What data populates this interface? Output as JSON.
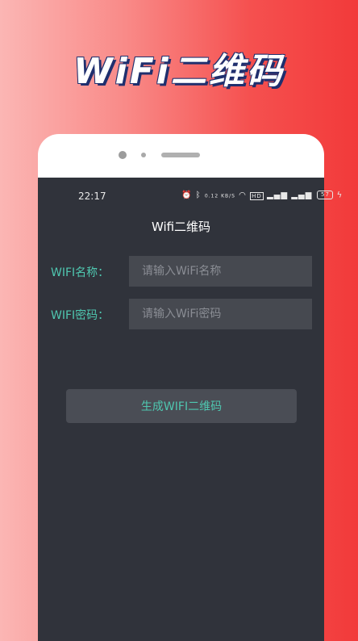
{
  "banner": {
    "title": "WiFi二维码"
  },
  "status_bar": {
    "time": "22:17",
    "net_speed": "0.12 KB/S",
    "hd_badge": "HD",
    "battery": "57",
    "icons": [
      "alarm-icon",
      "bluetooth-icon",
      "wifi-icon",
      "signal-icon",
      "signal-icon",
      "battery-icon",
      "charging-icon"
    ]
  },
  "app": {
    "title": "Wifi二维码",
    "ssid_label": "WIFI名称：",
    "ssid_placeholder": "请输入WiFi名称",
    "ssid_value": "",
    "password_label": "WIFI密码：",
    "password_placeholder": "请输入WiFi密码",
    "password_value": "",
    "generate_button": "生成WIFI二维码"
  },
  "colors": {
    "background_gradient": [
      "#fbb6b4",
      "#f23a3a"
    ],
    "screen_bg": "#30333b",
    "accent": "#4fc7b0",
    "input_bg": "#464950"
  }
}
